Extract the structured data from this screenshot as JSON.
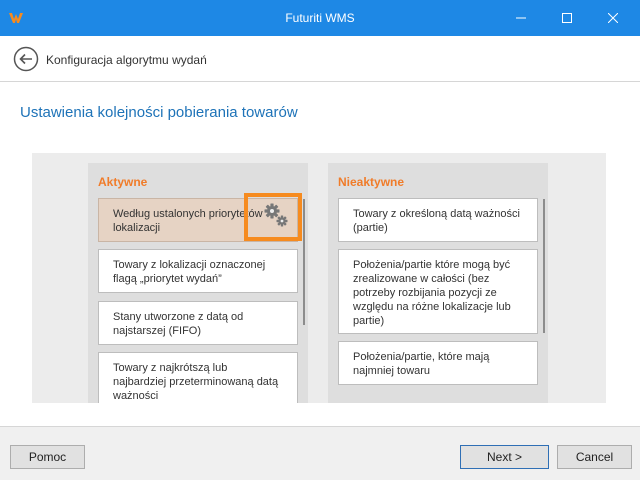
{
  "window": {
    "title": "Futuriti WMS",
    "accent_color": "#1e88e5",
    "logo_icon": "futuriti-logo-icon",
    "controls": [
      "minimize-icon",
      "maximize-icon",
      "close-icon"
    ]
  },
  "header": {
    "back_icon": "back-arrow-icon",
    "title": "Konfiguracja algorytmu wydań"
  },
  "page": {
    "title": "Ustawienia kolejności pobierania towarów"
  },
  "active": {
    "title": "Aktywne",
    "items": [
      "Według ustalonych priorytetów lokalizacji",
      "Towary z lokalizacji oznaczonej flagą „priorytet wydań”",
      "Stany utworzone z datą od najstarszej (FIFO)",
      "Towary z najkrótszą lub najbardziej przeterminowaną datą ważności"
    ],
    "selected_index": 0
  },
  "inactive": {
    "title": "Nieaktywne",
    "items": [
      "Towary z określoną datą ważności (partie)",
      "Położenia/partie które mogą być zrealizowane w całości (bez potrzeby rozbijania pozycji ze względu na różne lokalizacje lub partie)",
      "Położenia/partie, które mają najmniej towaru"
    ]
  },
  "settings_icon": "gears-icon",
  "highlight_color": "#f68b1f",
  "footer": {
    "help_label": "Pomoc",
    "next_label": "Next >",
    "cancel_label": "Cancel"
  }
}
